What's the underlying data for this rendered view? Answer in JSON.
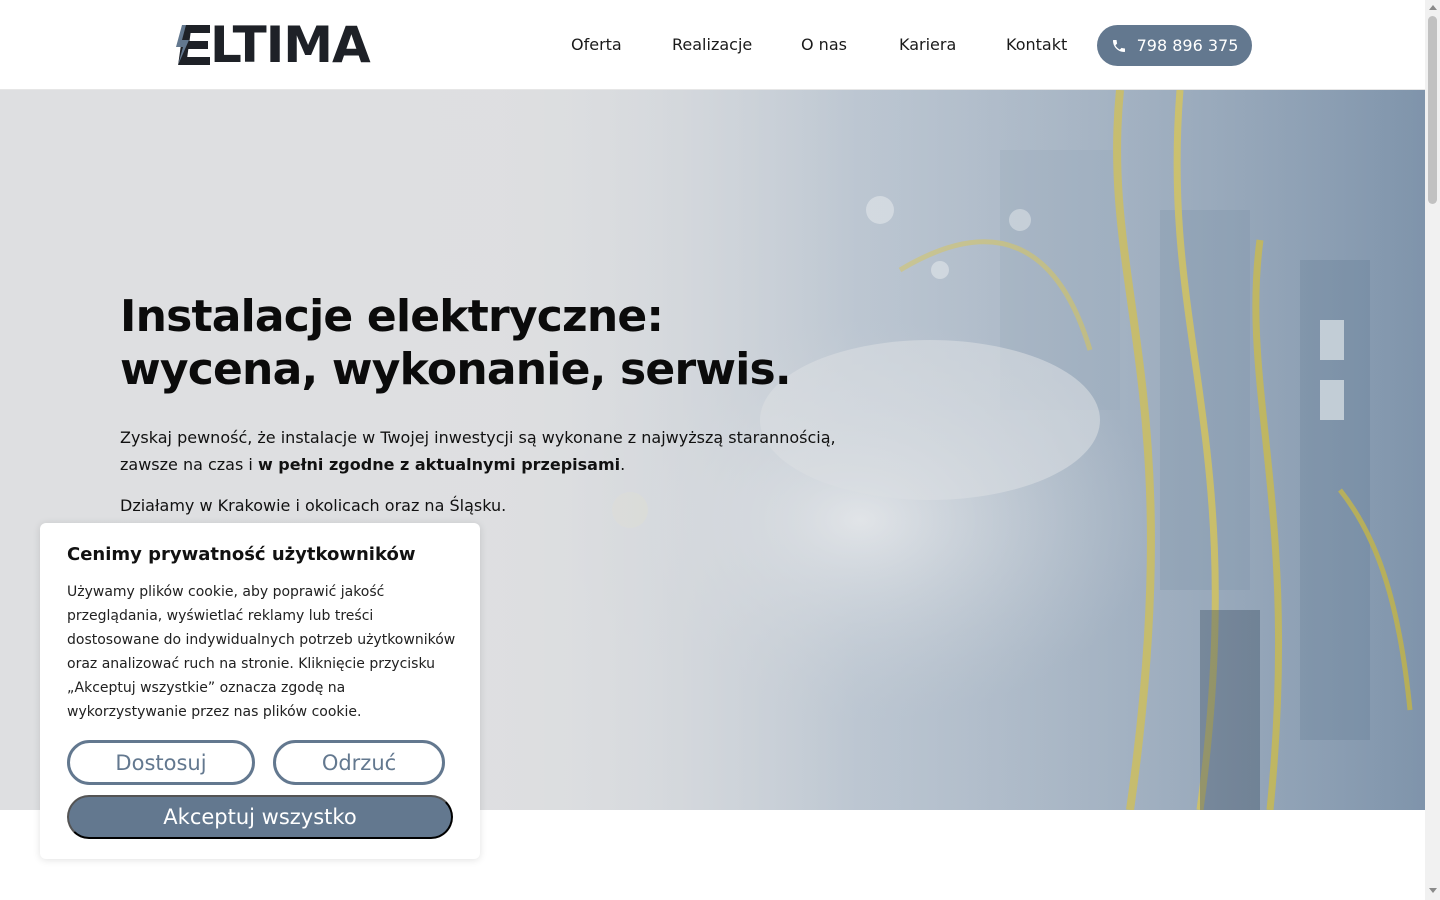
{
  "header": {
    "logo_text": "LTIMA",
    "nav": [
      "Oferta",
      "Realizacje",
      "O nas",
      "Kariera",
      "Kontakt"
    ],
    "phone": "798 896 375"
  },
  "hero": {
    "title_line1": "Instalacje elektryczne:",
    "title_line2": "wycena, wykonanie, serwis.",
    "text_plain": "Zyskaj pewność, że instalacje w Twojej inwestycji są wykonane z najwyższą starannością, zawsze na czas i ",
    "text_bold": "w pełni zgodne z aktualnymi przepisami",
    "text_end": ".",
    "area": "Działamy w Krakowie i okolicach oraz na Śląsku."
  },
  "cookie": {
    "title": "Cenimy prywatność użytkowników",
    "body": "Używamy plików cookie, aby poprawić jakość przeglądania, wyświetlać reklamy lub treści dostosowane do indywidualnych potrzeb użytkowników oraz analizować ruch na stronie. Kliknięcie przycisku „Akceptuj wszystkie” oznacza zgodę na wykorzystywanie przez nas plików cookie.",
    "btn_customize": "Dostosuj",
    "btn_reject": "Odrzuć",
    "btn_accept": "Akceptuj wszystko"
  },
  "colors": {
    "accent": "#63788f",
    "logo_dark": "#1e2127",
    "hero_bg": "#dedfe1"
  },
  "icons": {
    "logo_mark": "lightning-e-icon",
    "phone": "phone-icon"
  }
}
